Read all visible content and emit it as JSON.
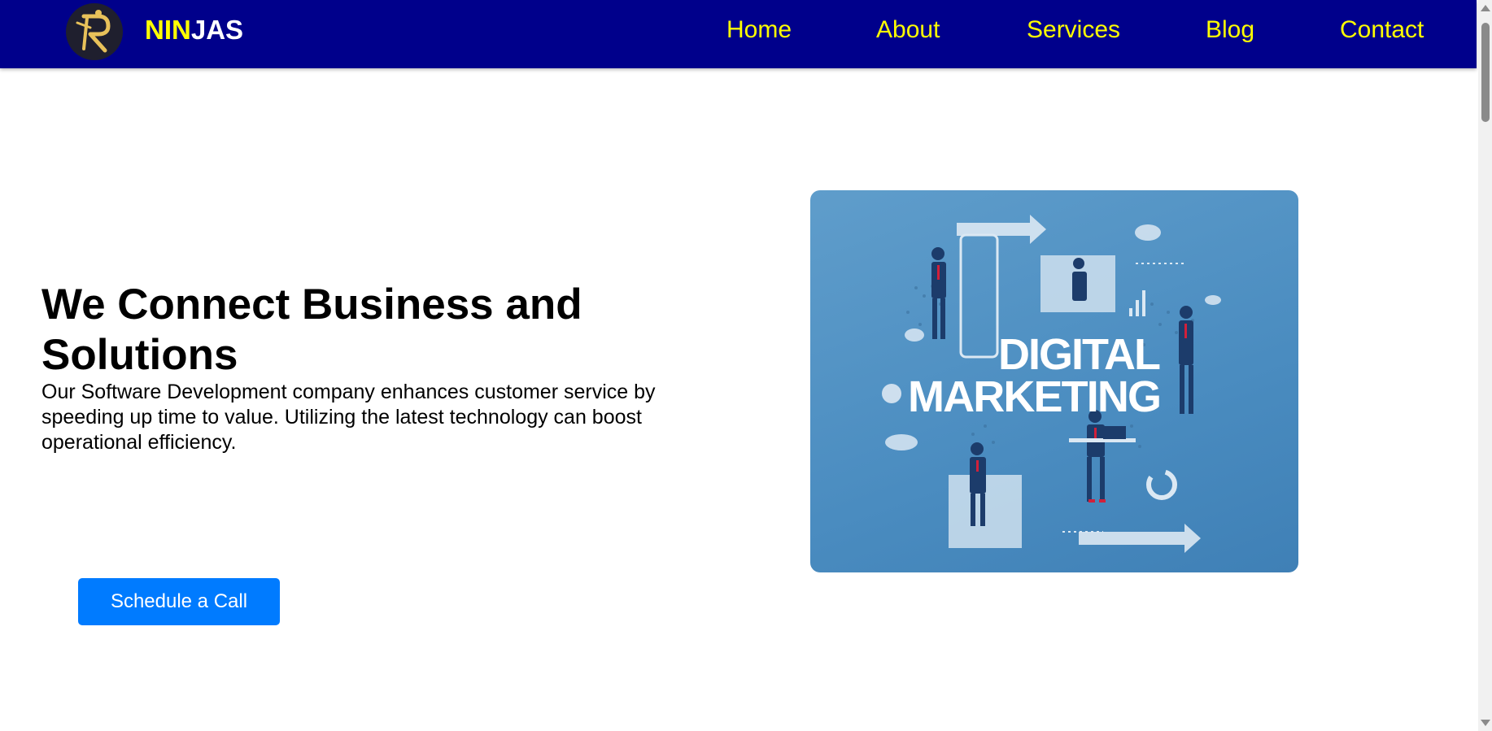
{
  "brand": {
    "part1": "NIN",
    "part2": "JAS",
    "logo_icon": "ninja-r-logo-icon"
  },
  "nav": {
    "items": [
      {
        "label": "Home"
      },
      {
        "label": "About"
      },
      {
        "label": "Services"
      },
      {
        "label": "Blog"
      },
      {
        "label": "Contact"
      }
    ]
  },
  "hero": {
    "title": "We Connect Business and Solutions",
    "description": "Our Software Development company enhances customer service by speeding up time to value. Utilizing the latest technology can boost operational efficiency.",
    "cta_label": "Schedule a Call",
    "image": {
      "line1": "DIGITAL",
      "line2": "MARKETING"
    }
  },
  "colors": {
    "nav_bg": "#00008b",
    "nav_text": "#ffff00",
    "cta_bg": "#007bff",
    "image_bg": "#4a8cc0"
  }
}
